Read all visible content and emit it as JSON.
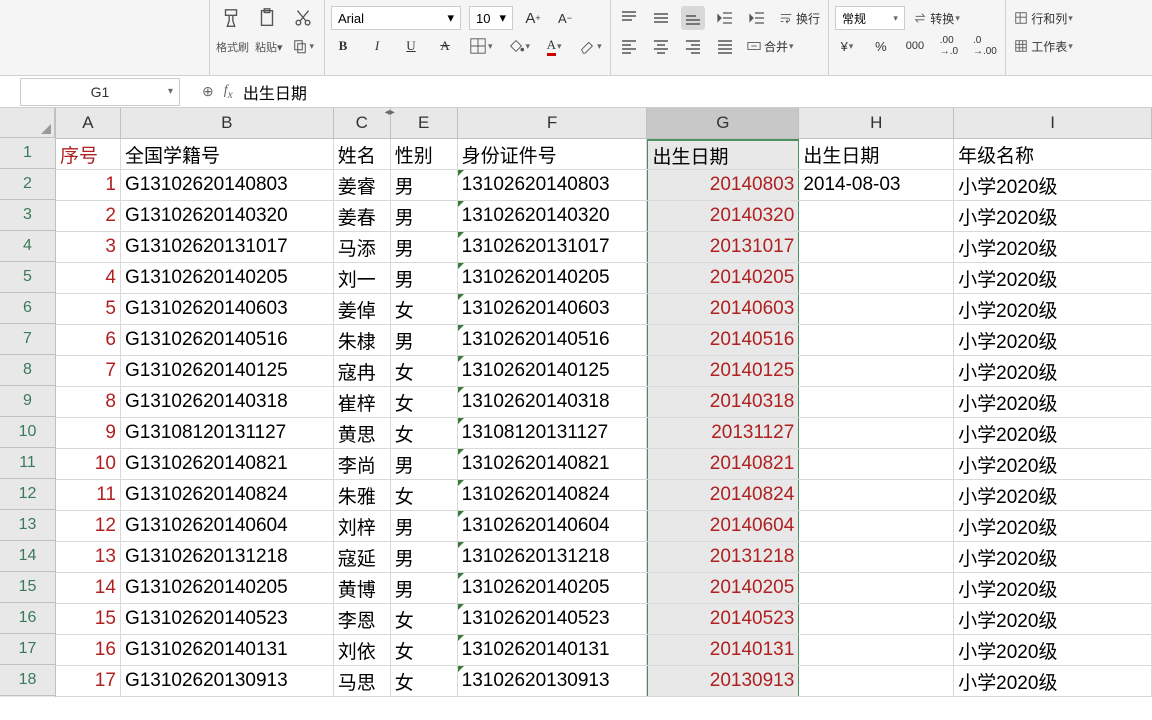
{
  "toolbar": {
    "paintbrush": "格式刷",
    "paste": "粘贴",
    "font_name": "Arial",
    "font_size": "10",
    "wrap": "换行",
    "merge": "合并",
    "number_format": "常规",
    "convert": "转换",
    "rows_cols": "行和列",
    "worksheet": "工作表"
  },
  "formula_bar": {
    "cell_ref": "G1",
    "formula": "出生日期"
  },
  "columns": [
    "A",
    "B",
    "C",
    "E",
    "F",
    "G",
    "H",
    "I"
  ],
  "headers": {
    "a": "序号",
    "b": "全国学籍号",
    "c": "姓名",
    "e": "性别",
    "f": "身份证件号",
    "g": "出生日期",
    "h": "出生日期",
    "i": "年级名称"
  },
  "rows": [
    {
      "n": "1",
      "a": "1",
      "b": "G13102620140803",
      "c": "姜睿",
      "e": "男",
      "f": "13102620140803",
      "g": "20140803",
      "h": "2014-08-03",
      "i": "小学2020级"
    },
    {
      "n": "2",
      "a": "2",
      "b": "G13102620140320",
      "c": "姜春",
      "e": "男",
      "f": "13102620140320",
      "g": "20140320",
      "h": "",
      "i": "小学2020级"
    },
    {
      "n": "3",
      "a": "3",
      "b": "G13102620131017",
      "c": "马添",
      "e": "男",
      "f": "13102620131017",
      "g": "20131017",
      "h": "",
      "i": "小学2020级"
    },
    {
      "n": "4",
      "a": "4",
      "b": "G13102620140205",
      "c": "刘一",
      "e": "男",
      "f": "13102620140205",
      "g": "20140205",
      "h": "",
      "i": "小学2020级"
    },
    {
      "n": "5",
      "a": "5",
      "b": "G13102620140603",
      "c": "姜倬",
      "e": "女",
      "f": "13102620140603",
      "g": "20140603",
      "h": "",
      "i": "小学2020级"
    },
    {
      "n": "6",
      "a": "6",
      "b": "G13102620140516",
      "c": "朱棣",
      "e": "男",
      "f": "13102620140516",
      "g": "20140516",
      "h": "",
      "i": "小学2020级"
    },
    {
      "n": "7",
      "a": "7",
      "b": "G13102620140125",
      "c": "寇冉",
      "e": "女",
      "f": "13102620140125",
      "g": "20140125",
      "h": "",
      "i": "小学2020级"
    },
    {
      "n": "8",
      "a": "8",
      "b": "G13102620140318",
      "c": "崔梓",
      "e": "女",
      "f": "13102620140318",
      "g": "20140318",
      "h": "",
      "i": "小学2020级"
    },
    {
      "n": "9",
      "a": "9",
      "b": "G13108120131127",
      "c": "黄思",
      "e": "女",
      "f": "13108120131127",
      "g": "20131127",
      "h": "",
      "i": "小学2020级"
    },
    {
      "n": "10",
      "a": "10",
      "b": "G13102620140821",
      "c": "李尚",
      "e": "男",
      "f": "13102620140821",
      "g": "20140821",
      "h": "",
      "i": "小学2020级"
    },
    {
      "n": "11",
      "a": "11",
      "b": "G13102620140824",
      "c": "朱雅",
      "e": "女",
      "f": "13102620140824",
      "g": "20140824",
      "h": "",
      "i": "小学2020级"
    },
    {
      "n": "12",
      "a": "12",
      "b": "G13102620140604",
      "c": "刘梓",
      "e": "男",
      "f": "13102620140604",
      "g": "20140604",
      "h": "",
      "i": "小学2020级"
    },
    {
      "n": "13",
      "a": "13",
      "b": "G13102620131218",
      "c": "寇延",
      "e": "男",
      "f": "13102620131218",
      "g": "20131218",
      "h": "",
      "i": "小学2020级"
    },
    {
      "n": "14",
      "a": "14",
      "b": "G13102620140205",
      "c": "黄博",
      "e": "男",
      "f": "13102620140205",
      "g": "20140205",
      "h": "",
      "i": "小学2020级"
    },
    {
      "n": "15",
      "a": "15",
      "b": "G13102620140523",
      "c": "李恩",
      "e": "女",
      "f": "13102620140523",
      "g": "20140523",
      "h": "",
      "i": "小学2020级"
    },
    {
      "n": "16",
      "a": "16",
      "b": "G13102620140131",
      "c": "刘依",
      "e": "女",
      "f": "13102620140131",
      "g": "20140131",
      "h": "",
      "i": "小学2020级"
    },
    {
      "n": "17",
      "a": "17",
      "b": "G13102620130913",
      "c": "马思",
      "e": "女",
      "f": "13102620130913",
      "g": "20130913",
      "h": "",
      "i": "小学2020级"
    }
  ]
}
